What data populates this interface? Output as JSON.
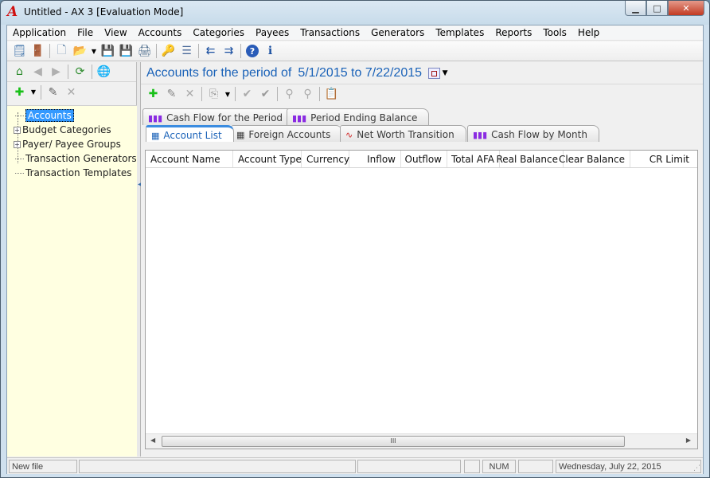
{
  "window": {
    "title": "Untitled - AX 3 [Evaluation Mode]",
    "logo": "A",
    "controls": {
      "minimize": "▁",
      "maximize": "□",
      "close": "✕"
    }
  },
  "menu": [
    "Application",
    "File",
    "View",
    "Accounts",
    "Categories",
    "Payees",
    "Transactions",
    "Generators",
    "Templates",
    "Reports",
    "Tools",
    "Help"
  ],
  "main_toolbar": [
    {
      "name": "properties-icon",
      "glyph": "🗒"
    },
    {
      "name": "exit-icon",
      "glyph": "🚪"
    },
    {
      "name": "new-file-icon",
      "glyph": "🗋"
    },
    {
      "name": "open-folder-icon",
      "glyph": "📂"
    },
    {
      "name": "save-icon",
      "glyph": "💾"
    },
    {
      "name": "save-as-icon",
      "glyph": "💾"
    },
    {
      "name": "print-icon",
      "glyph": "🖨"
    },
    {
      "name": "key-icon",
      "glyph": "🔑"
    },
    {
      "name": "list-icon",
      "glyph": "☰"
    },
    {
      "name": "import-icon",
      "glyph": "⇇"
    },
    {
      "name": "export-icon",
      "glyph": "⇉"
    },
    {
      "name": "help-icon",
      "glyph": "?"
    },
    {
      "name": "info-icon",
      "glyph": "ℹ"
    }
  ],
  "left_toolbar": {
    "home": "⌂",
    "back": "◀",
    "forward": "▶",
    "refresh": "⟳",
    "globe": "🌐",
    "add": "✚",
    "edit": "✎",
    "delete": "✕"
  },
  "tree": {
    "items": [
      {
        "label": "Accounts",
        "selected": true,
        "expandable": false
      },
      {
        "label": "Budget Categories",
        "selected": false,
        "expandable": true
      },
      {
        "label": "Payer/ Payee Groups",
        "selected": false,
        "expandable": true
      },
      {
        "label": "Transaction Generators",
        "selected": false,
        "expandable": false
      },
      {
        "label": "Transaction Templates",
        "selected": false,
        "expandable": false
      }
    ]
  },
  "period": {
    "title": "Accounts for the period of",
    "dates": "5/1/2015 to 7/22/2015"
  },
  "right_toolbar": {
    "add": "✚",
    "edit": "✎",
    "delete": "✕",
    "copy": "⎘",
    "check": "✔",
    "check_all": "✔",
    "filter": "⚲",
    "filter2": "⚲",
    "paste": "📋"
  },
  "tabs_back": [
    {
      "label": "Cash Flow for the Period",
      "icon": "bar-chart-icon"
    },
    {
      "label": "Period Ending Balance",
      "icon": "bar-chart-icon"
    }
  ],
  "tabs_front": [
    {
      "label": "Account List",
      "icon": "table-icon",
      "active": true
    },
    {
      "label": "Foreign Accounts",
      "icon": "table-icon",
      "active": false
    },
    {
      "label": "Net Worth Transition",
      "icon": "line-chart-icon",
      "active": false
    },
    {
      "label": "Cash Flow by Month",
      "icon": "bar-chart-icon",
      "active": false
    }
  ],
  "grid": {
    "columns": [
      "Account Name",
      "Account Type",
      "Currency",
      "Inflow",
      "Outflow",
      "Total AFA",
      "Real Balance",
      "Clear Balance",
      "CR Limit"
    ],
    "rows": []
  },
  "scrollbar": {
    "thumb_grip": "III",
    "left": "◀",
    "right": "▶"
  },
  "status": {
    "message": "New file",
    "num": "NUM",
    "date": "Wednesday, July 22, 2015"
  },
  "colors": {
    "accent": "#1a62b8",
    "tree_bg": "#ffffe1",
    "selection": "#3399ff"
  }
}
